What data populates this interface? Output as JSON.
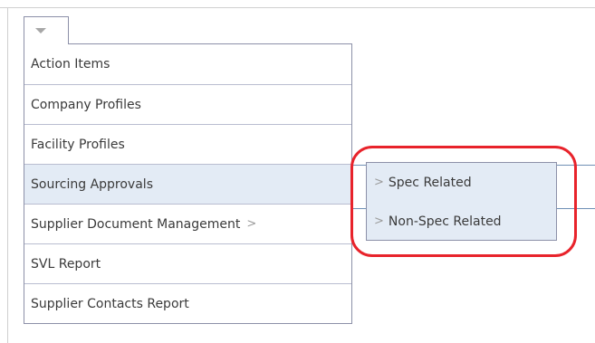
{
  "menu": {
    "items": [
      {
        "label": "Action Items"
      },
      {
        "label": "Company Profiles"
      },
      {
        "label": "Facility Profiles"
      },
      {
        "label": "Sourcing Approvals"
      },
      {
        "label": "Supplier Document Management"
      },
      {
        "label": "SVL Report"
      },
      {
        "label": "Supplier Contacts Report"
      }
    ],
    "submenu_indicator": ">"
  },
  "submenu": {
    "items": [
      {
        "label": "Spec Related"
      },
      {
        "label": "Non-Spec Related"
      }
    ]
  },
  "icons": {
    "trigger": "dropdown-arrow-icon",
    "chevron": "chevron-right-icon"
  },
  "colors": {
    "highlight": "#e8232b",
    "active_item_bg": "#e3ebf5",
    "border": "#8c90a8"
  }
}
